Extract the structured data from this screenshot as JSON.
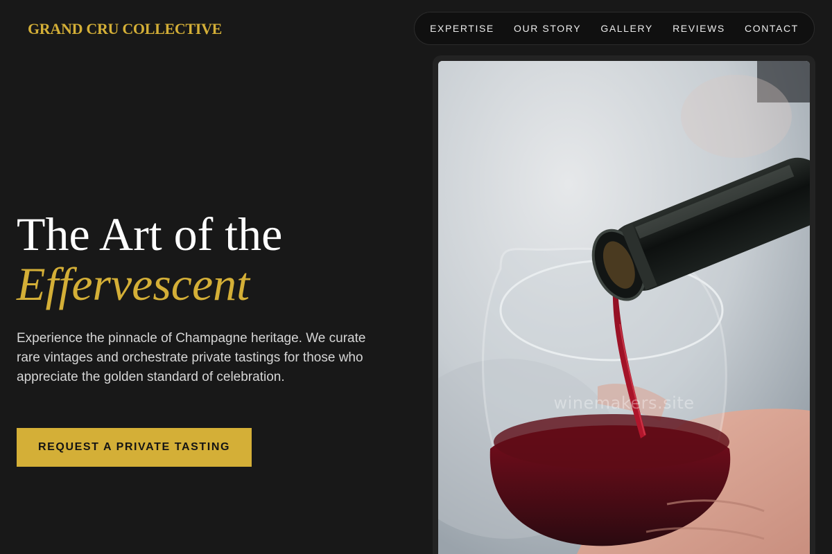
{
  "brand": {
    "name": "GRAND CRU COLLECTIVE",
    "accent": "#d4af37"
  },
  "nav": {
    "items": [
      {
        "label": "EXPERTISE"
      },
      {
        "label": "OUR STORY"
      },
      {
        "label": "GALLERY"
      },
      {
        "label": "REVIEWS"
      },
      {
        "label": "CONTACT"
      }
    ]
  },
  "hero": {
    "title_line1": "The Art of the",
    "title_line2": "Effervescent",
    "description": "Experience the pinnacle of Champagne heritage. We curate rare vintages and orchestrate private tastings for those who appreciate the golden standard of celebration.",
    "cta_label": "REQUEST A PRIVATE TASTING"
  },
  "image": {
    "subject": "wine being poured from bottle into glass",
    "watermark": "winemakers.site"
  }
}
